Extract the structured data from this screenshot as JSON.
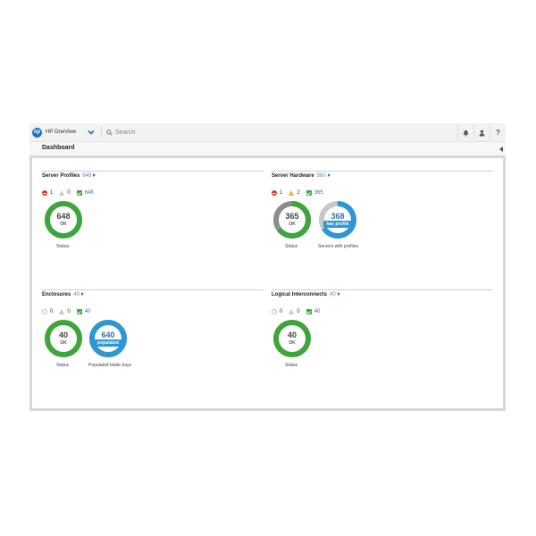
{
  "topbar": {
    "logo_glyph": "hp",
    "app_name": "HP OneView",
    "search_placeholder": "Search",
    "help_label": "?",
    "icons": [
      "menu-chevron-icon",
      "search-icon",
      "bell-icon",
      "user-icon",
      "help-icon"
    ]
  },
  "page": {
    "title": "Dashboard"
  },
  "colors": {
    "ok": "#3da53a",
    "critical": "#d9362b",
    "warning": "#f0b323",
    "blue": "#2e96d2",
    "gray": "#8c8c8c",
    "light_gray": "#c8c8c8"
  },
  "panels": {
    "server_profiles": {
      "title": "Server Profiles",
      "count": "649",
      "status": {
        "critical": "1",
        "warning": "0",
        "ok": "648"
      },
      "donuts": [
        {
          "value": "648",
          "label": "OK",
          "caption": "Status",
          "ok_fraction": 0.998
        }
      ]
    },
    "server_hardware": {
      "title": "Server Hardware",
      "count": "560",
      "status": {
        "critical": "1",
        "warning": "2",
        "ok": "365"
      },
      "donuts": [
        {
          "value": "365",
          "label": "OK",
          "caption": "Status",
          "ok_fraction": 0.65
        },
        {
          "value": "368",
          "label": "has profile",
          "caption": "Servers with profiles",
          "fraction": 0.66
        }
      ]
    },
    "enclosures": {
      "title": "Enclosures",
      "count": "40",
      "status": {
        "disabled": "0",
        "warning": "0",
        "ok": "40"
      },
      "donuts": [
        {
          "value": "40",
          "label": "OK",
          "caption": "Status",
          "ok_fraction": 1.0
        },
        {
          "value": "640",
          "label": "populated",
          "caption": "Populated blade bays",
          "fraction": 1.0
        }
      ]
    },
    "logical_interconnects": {
      "title": "Logical Interconnects",
      "count": "40",
      "status": {
        "disabled": "0",
        "warning": "0",
        "ok": "40"
      },
      "donuts": [
        {
          "value": "40",
          "label": "OK",
          "caption": "Status",
          "ok_fraction": 1.0
        }
      ]
    }
  }
}
